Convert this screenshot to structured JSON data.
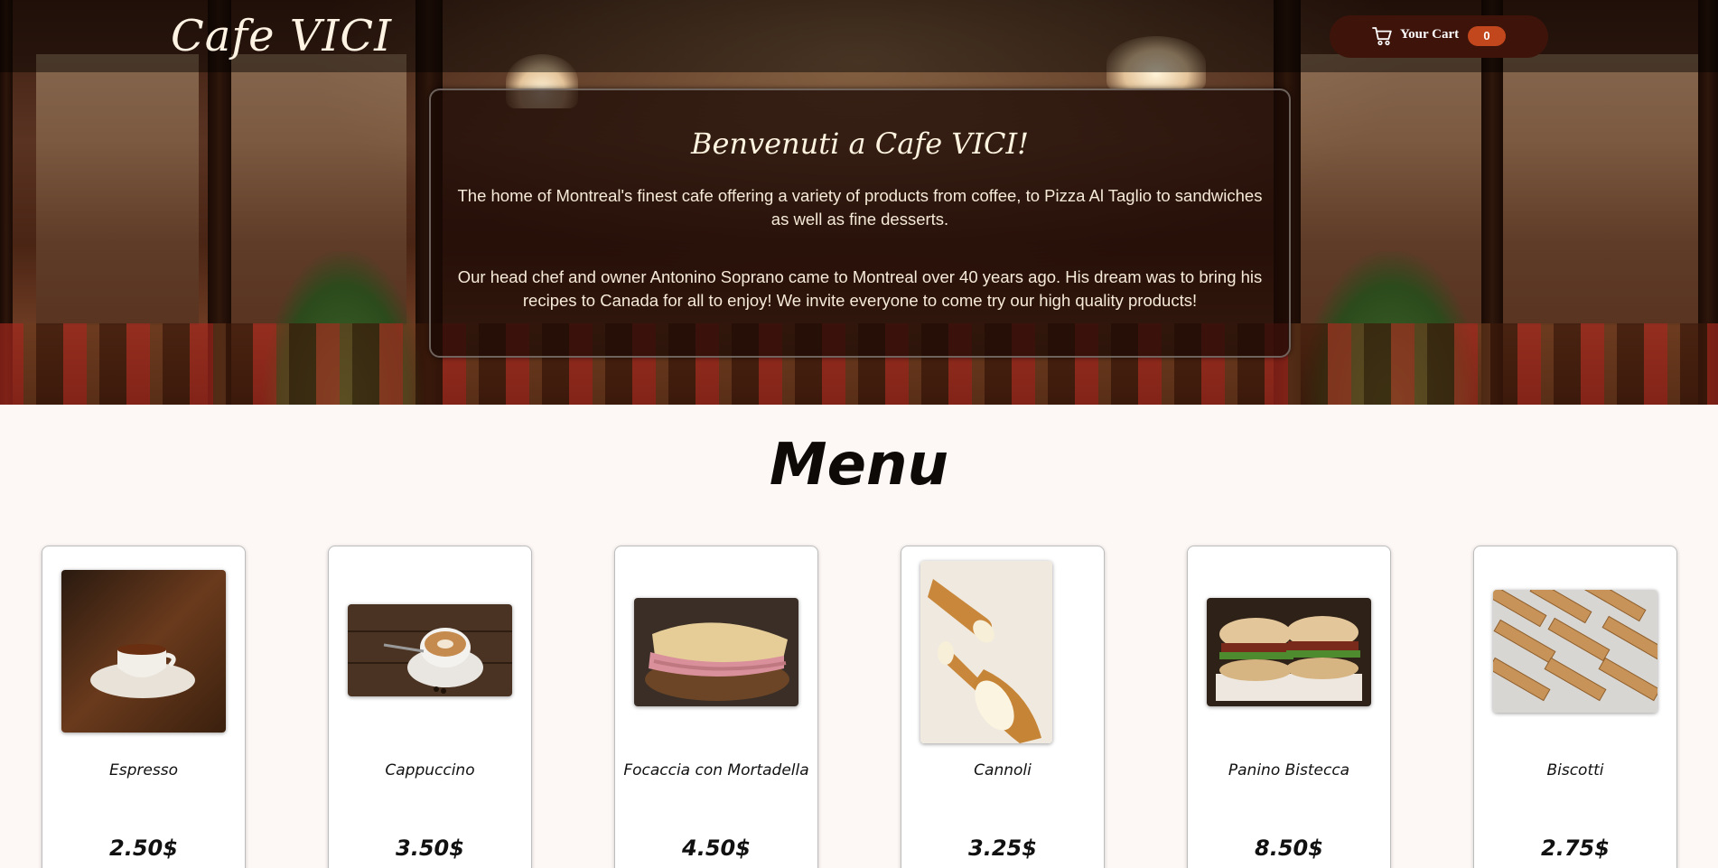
{
  "header": {
    "logo": "Cafe VICI",
    "cart_label": "Your Cart",
    "cart_count": "0",
    "cart_icon": "cart-icon"
  },
  "hero": {
    "title": "Benvenuti a Cafe VICI!",
    "paragraph1": "The home of Montreal's finest cafe offering a variety of products from coffee, to Pizza Al Taglio to sandwiches as well as fine desserts.",
    "paragraph2": "Our head chef and owner Antonino Soprano came to Montreal over 40 years ago. His dream was to bring his recipes to Canada for all to enjoy! We invite everyone to come try our high quality products!"
  },
  "menu": {
    "title": "Menu",
    "items": [
      {
        "name": "Espresso",
        "price": "2.50$"
      },
      {
        "name": "Cappuccino",
        "price": "3.50$"
      },
      {
        "name": "Focaccia con Mortadella",
        "price": "4.50$"
      },
      {
        "name": "Cannoli",
        "price": "3.25$"
      },
      {
        "name": "Panino Bistecca",
        "price": "8.50$"
      },
      {
        "name": "Biscotti",
        "price": "2.75$"
      }
    ]
  },
  "colors": {
    "cart_button": "#3e140a",
    "cart_badge": "#c2471c",
    "page_background": "#fdf8f6"
  }
}
